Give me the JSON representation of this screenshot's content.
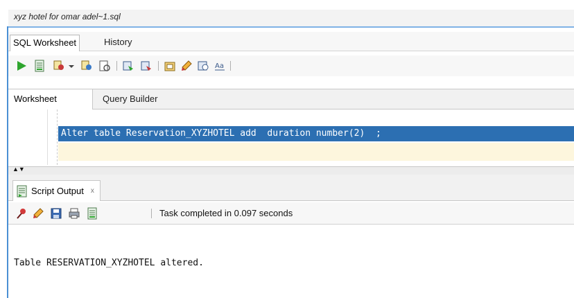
{
  "document": {
    "tab_label": "xyz hotel for omar adel~1.sql"
  },
  "sub_tabs": [
    {
      "label": "SQL Worksheet"
    },
    {
      "label": "History"
    }
  ],
  "toolbar": {
    "icons": [
      "run-statement-icon",
      "run-script-icon",
      "commit-icon",
      "dropdown-arrow-icon",
      "rollback-icon",
      "unshared-sql-icon",
      "explain-plan-icon",
      "autotrace-icon",
      "sql-tuning-icon",
      "clear-icon",
      "sql-history-icon",
      "format-case-icon"
    ]
  },
  "worksheet_tabs": [
    {
      "label": "Worksheet"
    },
    {
      "label": "Query Builder"
    }
  ],
  "editor": {
    "line": "Alter table Reservation_XYZHOTEL add  duration number(2)  ;"
  },
  "output_panel": {
    "tab_label": "Script Output",
    "close_symbol": "x",
    "status": "Task completed in 0.097 seconds",
    "text": "Table RESERVATION_XYZHOTEL altered."
  },
  "colors": {
    "selection": "#2c6fb2",
    "current_line": "#fdf6dd",
    "accent_border": "#7fb2e5"
  }
}
